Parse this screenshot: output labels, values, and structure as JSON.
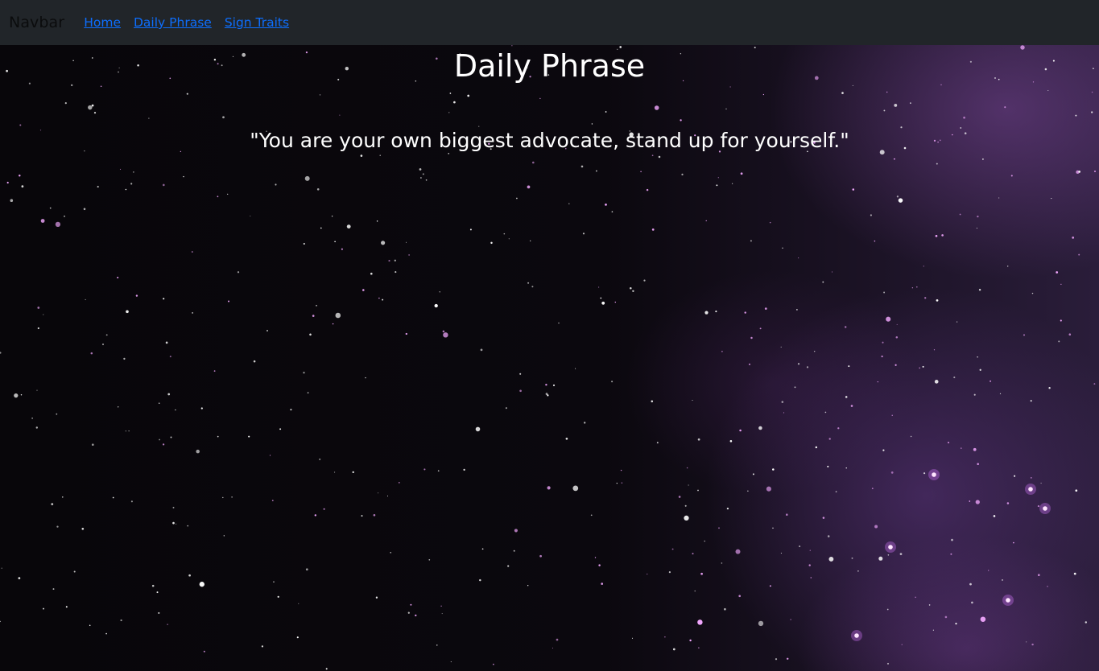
{
  "navbar": {
    "brand": "Navbar",
    "links": [
      {
        "label": "Home"
      },
      {
        "label": "Daily Phrase"
      },
      {
        "label": "Sign Traits"
      }
    ]
  },
  "main": {
    "title": "Daily Phrase",
    "phrase": "\"You are your own biggest advocate, stand up for yourself.\""
  },
  "colors": {
    "navbar_bg": "#212529",
    "link": "#0d6efd",
    "text": "#ffffff"
  }
}
